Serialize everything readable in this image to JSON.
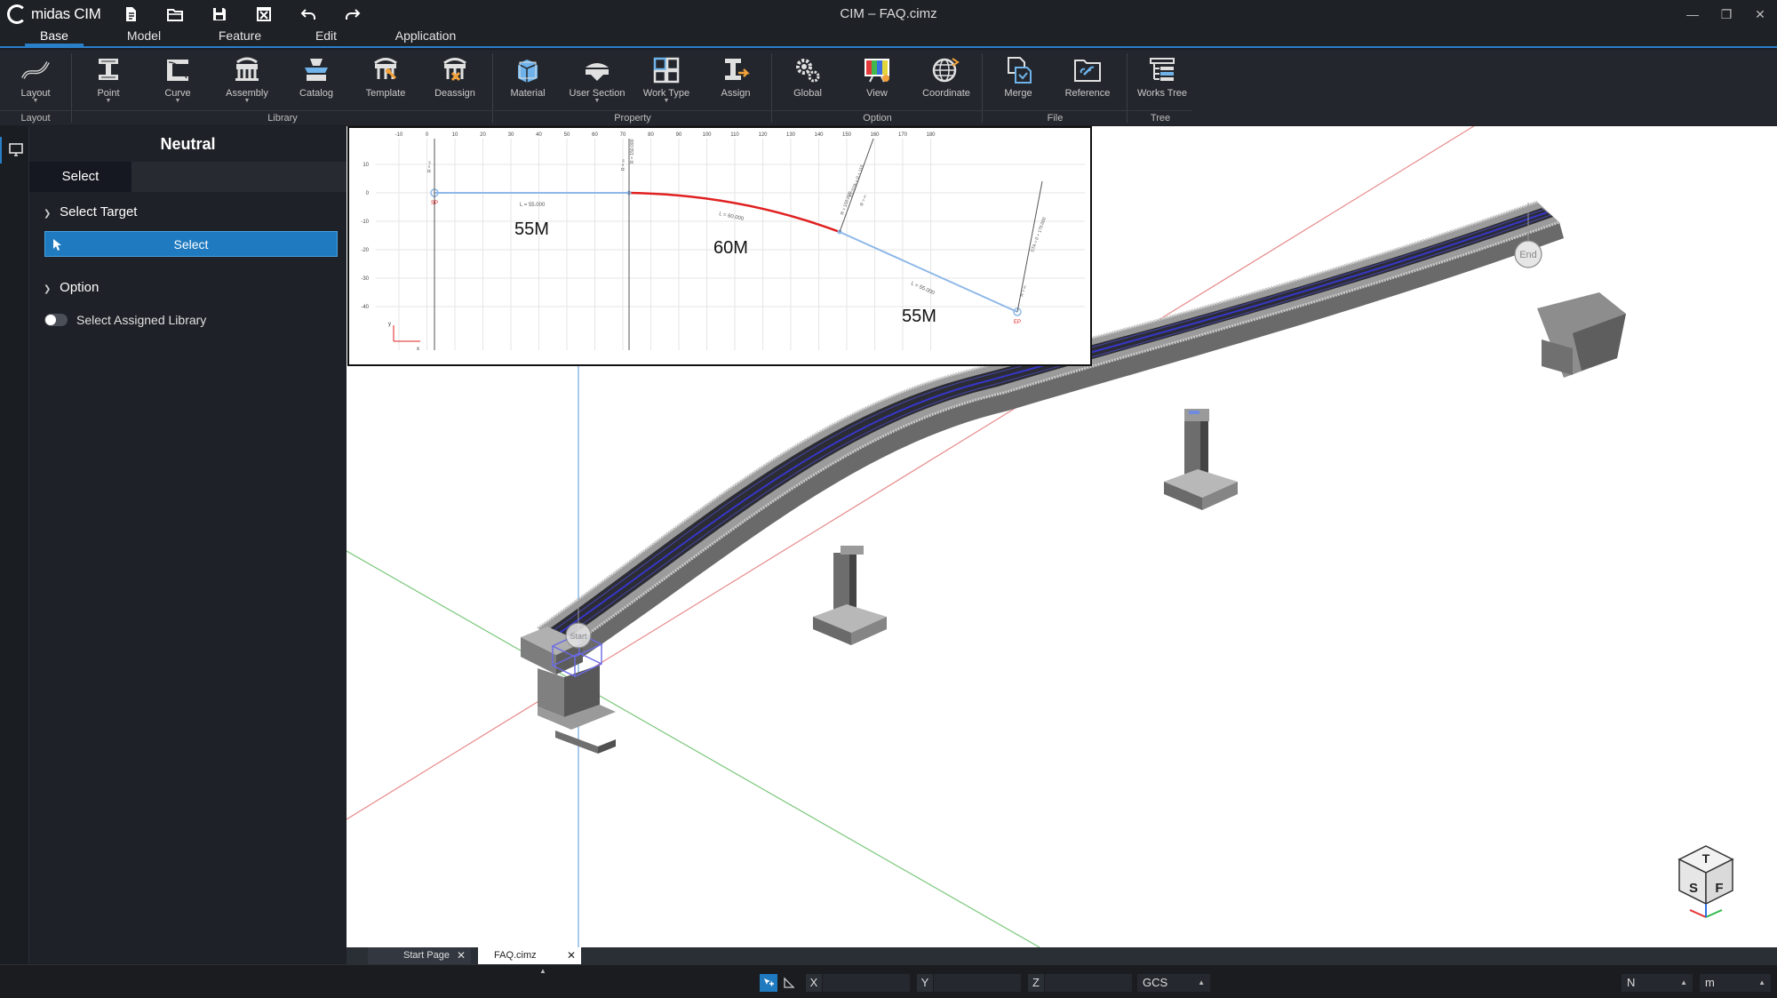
{
  "app": {
    "brand": "midas CIM",
    "window_title": "CIM – FAQ.cimz"
  },
  "quick_access": [
    "new-file-icon",
    "open-folder-icon",
    "save-icon",
    "close-file-icon",
    "undo-icon",
    "redo-icon"
  ],
  "tabs": [
    {
      "label": "Base",
      "active": true
    },
    {
      "label": "Model",
      "active": false
    },
    {
      "label": "Feature",
      "active": false
    },
    {
      "label": "Edit",
      "active": false
    },
    {
      "label": "Application",
      "active": false
    }
  ],
  "ribbon": {
    "buttons": {
      "layout": "Layout",
      "point": "Point",
      "curve": "Curve",
      "assembly": "Assembly",
      "catalog": "Catalog",
      "template": "Template",
      "deassign": "Deassign",
      "material": "Material",
      "user_section": "User Section",
      "work_type": "Work Type",
      "assign": "Assign",
      "global": "Global",
      "view": "View",
      "coordinate": "Coordinate",
      "merge": "Merge",
      "reference": "Reference",
      "works_tree": "Works Tree"
    },
    "groups": {
      "layout": "Layout",
      "library": "Library",
      "property": "Property",
      "option": "Option",
      "file": "File",
      "tree": "Tree"
    }
  },
  "panel": {
    "title": "Neutral",
    "tab": "Select",
    "select_target": {
      "header": "Select Target",
      "button": "Select"
    },
    "option": {
      "header": "Option",
      "toggle_label": "Select Assigned Library",
      "toggle_on": false
    }
  },
  "inset": {
    "x_ticks": [
      "-10",
      "0",
      "10",
      "20",
      "30",
      "40",
      "50",
      "60",
      "70",
      "80",
      "90",
      "100",
      "110",
      "120",
      "130",
      "140",
      "150",
      "160",
      "170",
      "180"
    ],
    "y_ticks": [
      "10",
      "0",
      "-10",
      "-20",
      "-30",
      "-40"
    ],
    "segments": {
      "first": "55M",
      "middle": "60M",
      "last": "55M"
    },
    "seg_small": {
      "first": "L = 55.000",
      "middle": "L = 60.000",
      "last": "L = 55.000"
    },
    "markers": {
      "start": "SP",
      "end": "EP"
    },
    "vertical_labels": {
      "v1": "R = ∞",
      "v2": "R = ∞",
      "v3": "R = 150.000",
      "v4": "R = 150.000",
      "v5": "ECSTA = 0 + 115",
      "v6": "R = ∞",
      "v7": "STA = 0 + 170.000",
      "v8": "R = ∞"
    },
    "axis": {
      "x": "x",
      "y": "y"
    }
  },
  "viewport": {
    "end_label": "End",
    "start_label": "Start",
    "view_cube": {
      "top": "T",
      "left": "S",
      "right": "F"
    }
  },
  "doc_tabs": [
    {
      "label": "Start Page",
      "active": false
    },
    {
      "label": "FAQ.cimz",
      "active": true
    }
  ],
  "status": {
    "x_label": "X",
    "y_label": "Y",
    "z_label": "Z",
    "x_value": "",
    "y_value": "",
    "z_value": "",
    "coord_system": "GCS",
    "force_unit": "N",
    "length_unit": "m"
  },
  "colors": {
    "accent": "#2a7fc9",
    "panel_bg": "#1e2127",
    "select_button": "#1f7ac0",
    "curve_red": "#e02020",
    "line_blue": "#7aaee0"
  }
}
